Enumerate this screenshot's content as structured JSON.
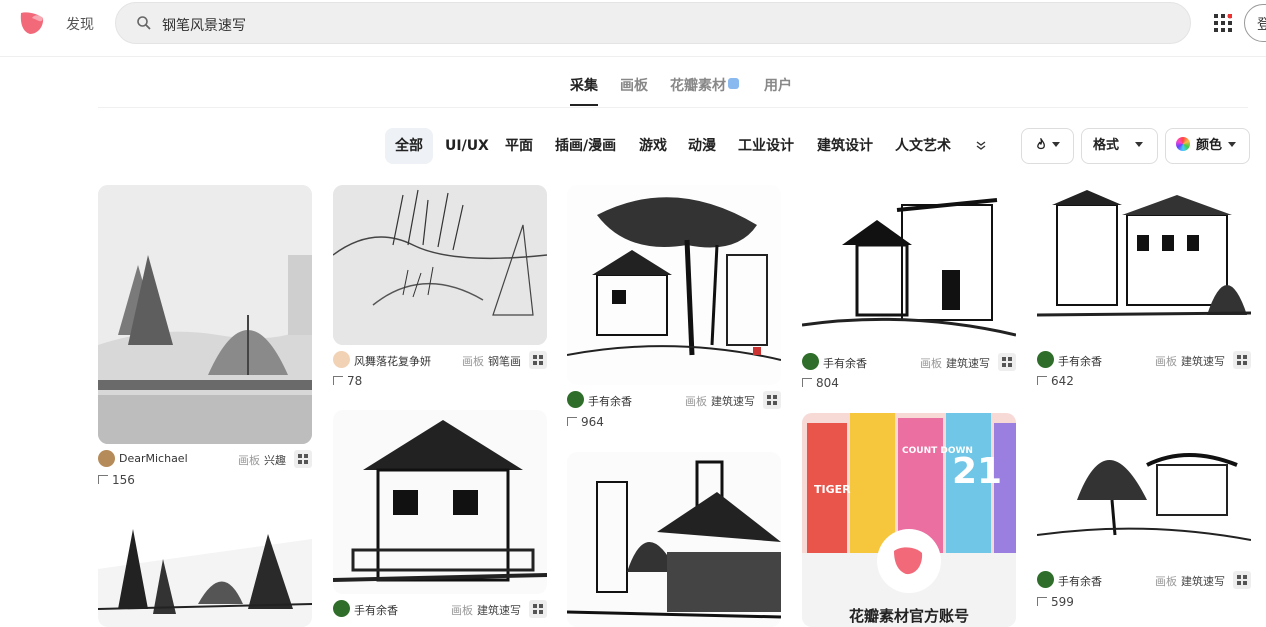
{
  "header": {
    "discover": "发现",
    "search_value": "钢笔风景速写",
    "login": "登"
  },
  "tabs": [
    "采集",
    "画板",
    "花瓣素材",
    "用户"
  ],
  "categories": [
    "全部",
    "UI/UX",
    "平面",
    "插画/漫画",
    "游戏",
    "动漫",
    "工业设计",
    "建筑设计",
    "人文艺术"
  ],
  "filters": {
    "format": "格式",
    "color": "颜色"
  },
  "board_prefix": "画板",
  "pins": [
    {
      "user": "DearMichael",
      "board": "兴趣",
      "count": "156"
    },
    {
      "user": "风舞落花复争妍",
      "board": "钢笔画",
      "count": "78"
    },
    {
      "user": "手有余香",
      "board": "建筑速写",
      "count": "964"
    },
    {
      "user": "手有余香",
      "board": "建筑速写",
      "count": "804"
    },
    {
      "user": "手有余香",
      "board": "建筑速写",
      "count": "642"
    },
    {
      "user": "手有余香",
      "board": "建筑速写",
      "count": ""
    },
    {
      "user": "手有余香",
      "board": "建筑速写",
      "count": "599"
    }
  ],
  "ad": {
    "title": "花瓣素材官方账号",
    "poster_text": [
      "TIGER",
      "COUNT DOWN",
      "21"
    ]
  },
  "colors": {
    "brand": "#f26a7a",
    "active_tab": "#222222"
  }
}
